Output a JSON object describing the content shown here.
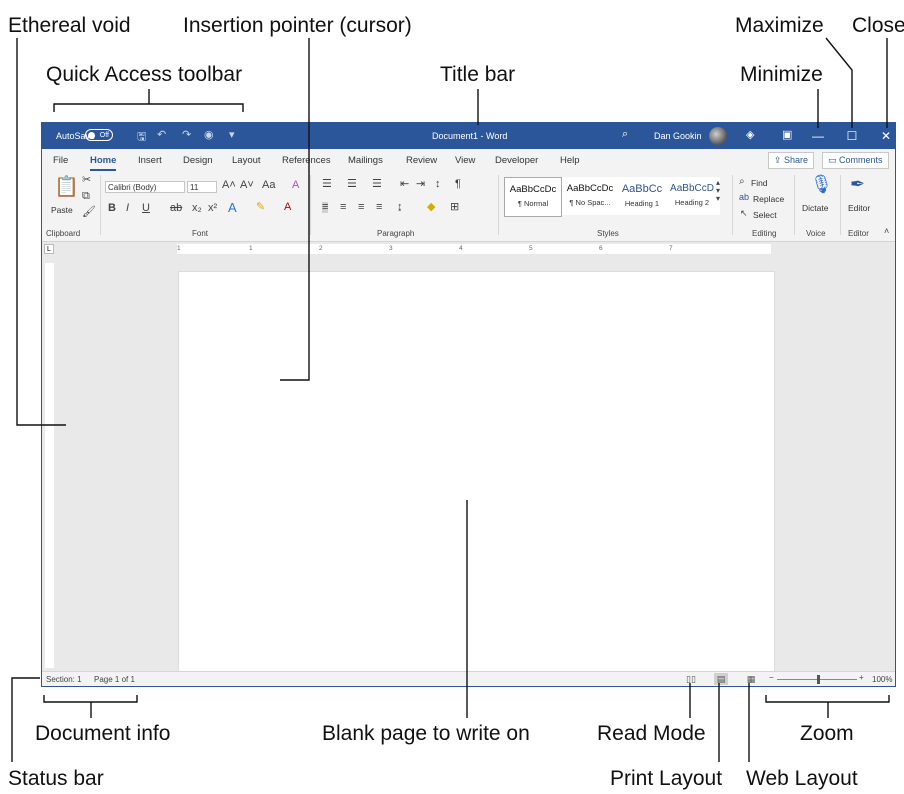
{
  "callouts": {
    "ethereal_void": "Ethereal void",
    "insertion_pointer": "Insertion pointer (cursor)",
    "maximize": "Maximize",
    "close": "Close",
    "quick_access": "Quick Access toolbar",
    "title_bar": "Title bar",
    "minimize": "Minimize",
    "document_info": "Document info",
    "blank_page": "Blank page to write on",
    "read_mode": "Read Mode",
    "zoom": "Zoom",
    "status_bar": "Status bar",
    "print_layout": "Print Layout",
    "web_layout": "Web Layout"
  },
  "titlebar": {
    "autosave": "AutoSave",
    "toggle": "Off",
    "doc_title": "Document1 - Word",
    "user": "Dan Gookin",
    "minimize": "—",
    "maximize": "☐",
    "close": "✕"
  },
  "menu": {
    "tabs": [
      "File",
      "Home",
      "Insert",
      "Design",
      "Layout",
      "References",
      "Mailings",
      "Review",
      "View",
      "Developer",
      "Help"
    ],
    "share": "Share",
    "comments": "Comments"
  },
  "ribbon": {
    "paste": "Paste",
    "font_name": "Calibri (Body)",
    "font_size": "11",
    "groups": {
      "clipboard": "Clipboard",
      "font": "Font",
      "paragraph": "Paragraph",
      "styles": "Styles",
      "editing": "Editing",
      "voice": "Voice",
      "editor": "Editor"
    },
    "styles": [
      {
        "preview": "AaBbCcDc",
        "name": "¶ Normal"
      },
      {
        "preview": "AaBbCcDc",
        "name": "¶ No Spac..."
      },
      {
        "preview": "AaBbCc",
        "name": "Heading 1"
      },
      {
        "preview": "AaBbCcD",
        "name": "Heading 2"
      }
    ],
    "find": "Find",
    "replace": "Replace",
    "select": "Select",
    "dictate": "Dictate",
    "editor_btn": "Editor"
  },
  "ruler": {
    "marks": [
      "1",
      "1",
      "2",
      "3",
      "4",
      "5",
      "6",
      "7"
    ]
  },
  "statusbar": {
    "section": "Section: 1",
    "page": "Page 1 of 1",
    "zoom": "100%"
  }
}
